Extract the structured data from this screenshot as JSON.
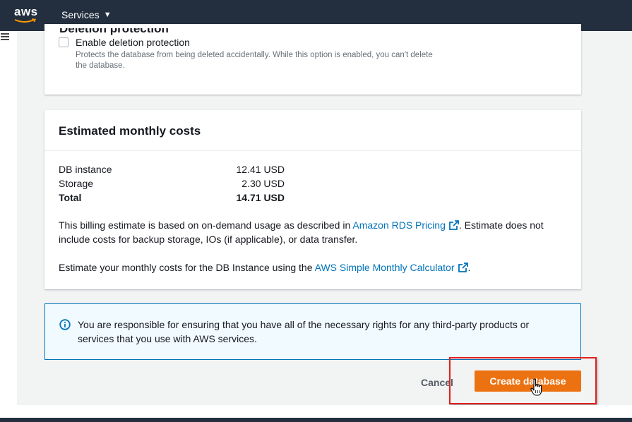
{
  "nav": {
    "logo_text": "aws",
    "services_label": "Services",
    "services_caret": "▼"
  },
  "deletion": {
    "heading": "Deletion protection",
    "checkbox_label": "Enable deletion protection",
    "checkbox_checked": false,
    "description": "Protects the database from being deleted accidentally. While this option is enabled, you can't delete the database."
  },
  "costs": {
    "title": "Estimated monthly costs",
    "rows": [
      {
        "label": "DB instance",
        "value": "12.41 USD"
      },
      {
        "label": "Storage",
        "value": "2.30 USD"
      },
      {
        "label": "Total",
        "value": "14.71 USD"
      }
    ],
    "billing_prefix": "This billing estimate is based on on-demand usage as described in ",
    "billing_link": "Amazon RDS Pricing",
    "billing_suffix": ". Estimate does not include costs for backup storage, IOs (if applicable), or data transfer.",
    "calc_prefix": "Estimate your monthly costs for the DB Instance using the ",
    "calc_link": "AWS Simple Monthly Calculator",
    "calc_suffix": "."
  },
  "info": {
    "text": "You are responsible for ensuring that you have all of the necessary rights for any third-party products or services that you use with AWS services."
  },
  "actions": {
    "cancel_label": "Cancel",
    "create_label": "Create database"
  },
  "colors": {
    "nav_bg": "#232f3e",
    "primary_orange": "#ec7211",
    "link_blue": "#0073bb",
    "highlight_red": "#e0201f"
  },
  "icons": {
    "menu": "hamburger-icon",
    "external": "external-link-icon",
    "info": "info-icon",
    "cursor": "hand-pointer-icon"
  }
}
